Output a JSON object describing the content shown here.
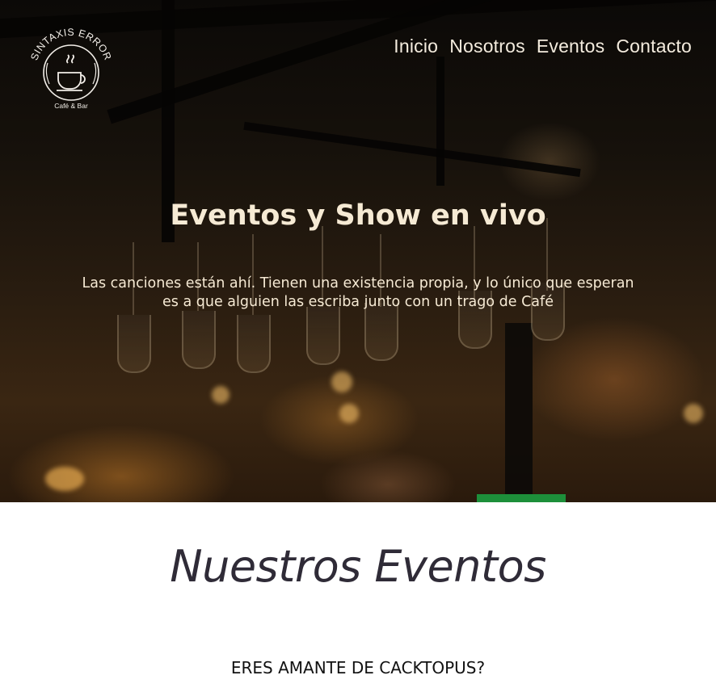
{
  "logo": {
    "name": "SINTAXIS ERROR",
    "tagline": "Café & Bar",
    "icon": "coffee-cup-icon"
  },
  "nav": {
    "items": [
      {
        "label": "Inicio"
      },
      {
        "label": "Nosotros"
      },
      {
        "label": "Eventos"
      },
      {
        "label": "Contacto"
      }
    ]
  },
  "hero": {
    "title": "Eventos y Show en vivo",
    "subtitle": "Las canciones están ahí. Tienen una existencia propia, y lo único que esperan es a que alguien las escriba junto con un trago de Café"
  },
  "events": {
    "section_title": "Nuestros Eventos",
    "first_event_title": "ERES AMANTE DE CACKTOPUS?"
  },
  "colors": {
    "hero_text": "#f6ead4",
    "section_title": "#2f2b37",
    "page_background": "#ffffff"
  }
}
